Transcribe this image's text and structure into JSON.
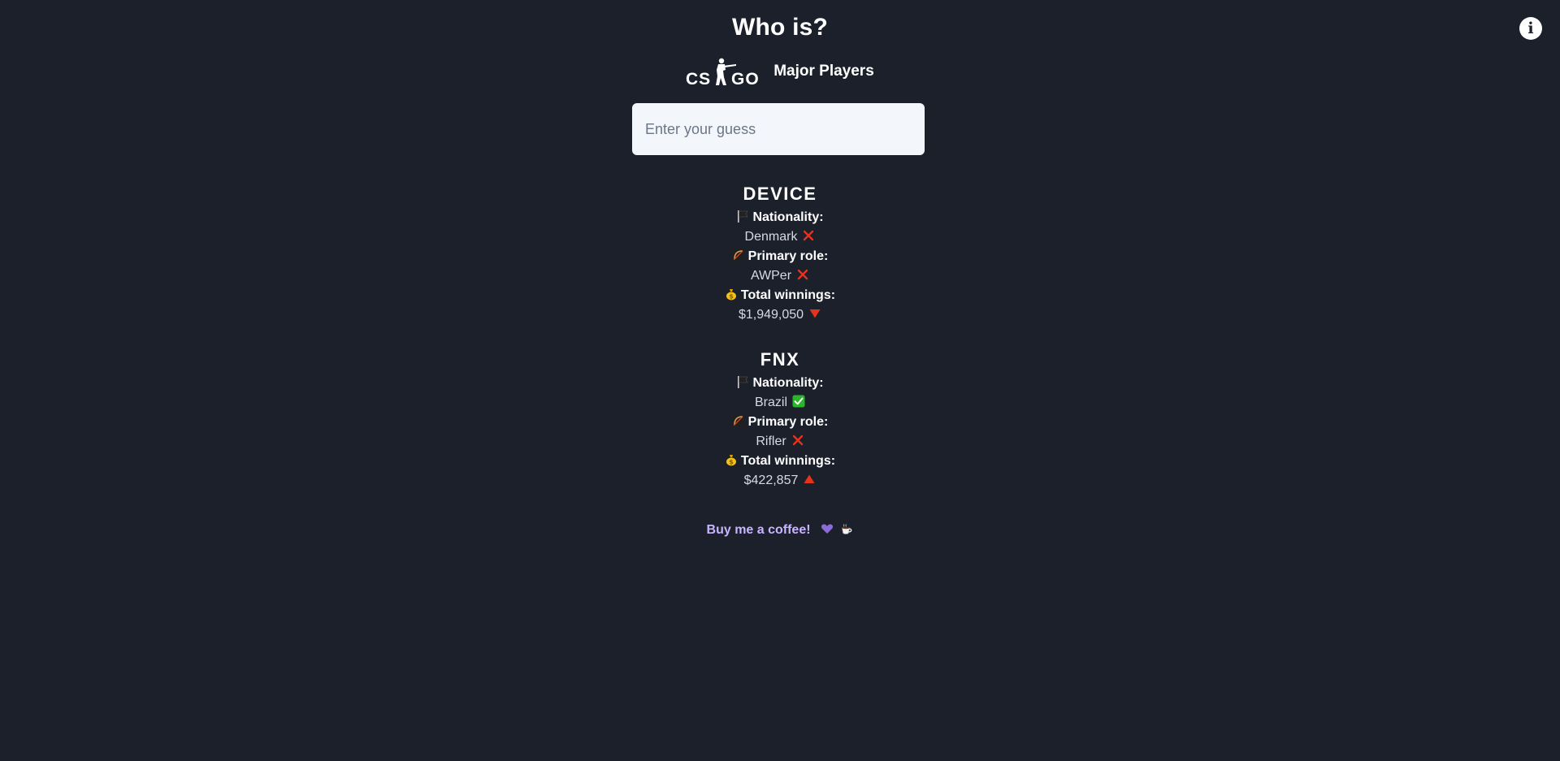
{
  "header": {
    "title": "Who is?",
    "subtitle": "Major Players",
    "logo_name": "CS:GO logo"
  },
  "info_button": {
    "label": "i"
  },
  "search": {
    "placeholder": "Enter your guess",
    "value": ""
  },
  "guesses": [
    {
      "name": "DEVICE",
      "nationality_label": "Nationality:",
      "nationality": "Denmark",
      "nationality_match": "wrong",
      "role_label": "Primary role:",
      "role": "AWPer",
      "role_match": "wrong",
      "winnings_label": "Total winnings:",
      "winnings": "$1,949,050",
      "winnings_hint": "lower"
    },
    {
      "name": "FNX",
      "nationality_label": "Nationality:",
      "nationality": "Brazil",
      "nationality_match": "correct",
      "role_label": "Primary role:",
      "role": "Rifler",
      "role_match": "wrong",
      "winnings_label": "Total winnings:",
      "winnings": "$422,857",
      "winnings_hint": "higher"
    }
  ],
  "footer": {
    "coffee_label": "Buy me a coffee!",
    "icons": [
      "purple-heart-icon",
      "hot-beverage-icon"
    ]
  },
  "colors": {
    "background": "#1b202b",
    "input_background": "#f3f7fb",
    "wrong_mark": "#e8321c",
    "correct_mark": "#2bb52b",
    "coffee_link": "#c8b4ff",
    "heart": "#8b6bd8"
  }
}
